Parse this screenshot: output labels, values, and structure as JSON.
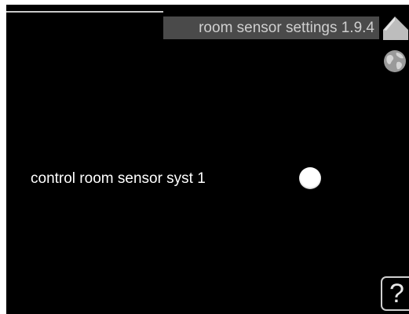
{
  "header": {
    "title": "room sensor settings 1.9.4"
  },
  "icons": {
    "home": "home-icon",
    "globe": "globe-icon",
    "help": "help-icon"
  },
  "setting": {
    "label": "control room sensor syst 1",
    "selected": false
  },
  "help": {
    "label": "?"
  },
  "colors": {
    "background": "#000000",
    "title_bar": "#4a4a4a",
    "text": "#ffffff",
    "icon": "#bdbdbd"
  }
}
